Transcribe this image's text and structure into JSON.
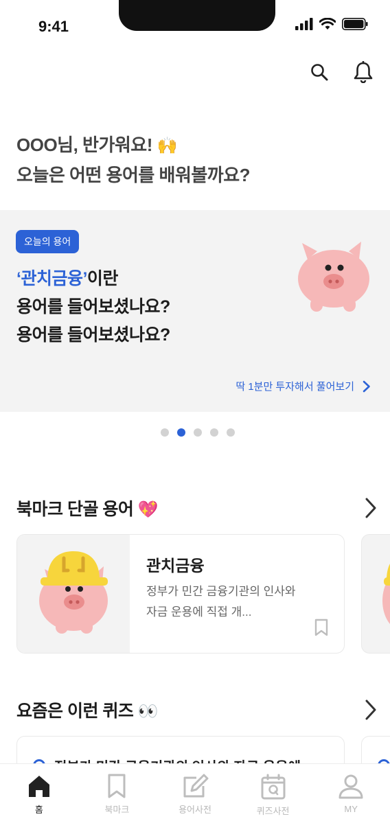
{
  "status_bar": {
    "time": "9:41"
  },
  "header": {
    "icons": [
      "search-icon",
      "bell-icon"
    ]
  },
  "greeting": {
    "line1": "OOO님, 반가워요!",
    "line1_emoji": "🙌",
    "line2": "오늘은 어떤 용어를 배워볼까요?"
  },
  "hero": {
    "badge": "오늘의 용어",
    "term": "‘관치금융’",
    "title_suffix": "이란",
    "line2": "용어를 들어보셨나요?",
    "line3": "용어를 들어보셨나요?",
    "cta": "딱 1분만 투자해서 풀어보기",
    "colors": {
      "accent": "#2c62d6",
      "background": "#f3f3f3",
      "pig": "#f6b8b8"
    }
  },
  "carousel": {
    "page_count": 5,
    "active_index": 1
  },
  "bookmarks": {
    "title": "북마크 단골 용어",
    "emoji": "💖",
    "card": {
      "title": "관치금융",
      "description": "정부가 민간 금융기관의 인사와 자금 운용에 직접 개..."
    }
  },
  "quiz": {
    "title": "요즘은 이런 퀴즈",
    "emoji": "👀",
    "card_text": "정부가 민간 금융기관의 인사와 자금 운용에"
  },
  "tabbar": {
    "items": [
      {
        "label": "홈",
        "icon": "home-icon",
        "active": true
      },
      {
        "label": "북마크",
        "icon": "bookmark-icon",
        "active": false
      },
      {
        "label": "용어사전",
        "icon": "edit-icon",
        "active": false
      },
      {
        "label": "퀴즈사전",
        "icon": "calendar-q-icon",
        "active": false
      },
      {
        "label": "MY",
        "icon": "person-icon",
        "active": false
      }
    ]
  }
}
